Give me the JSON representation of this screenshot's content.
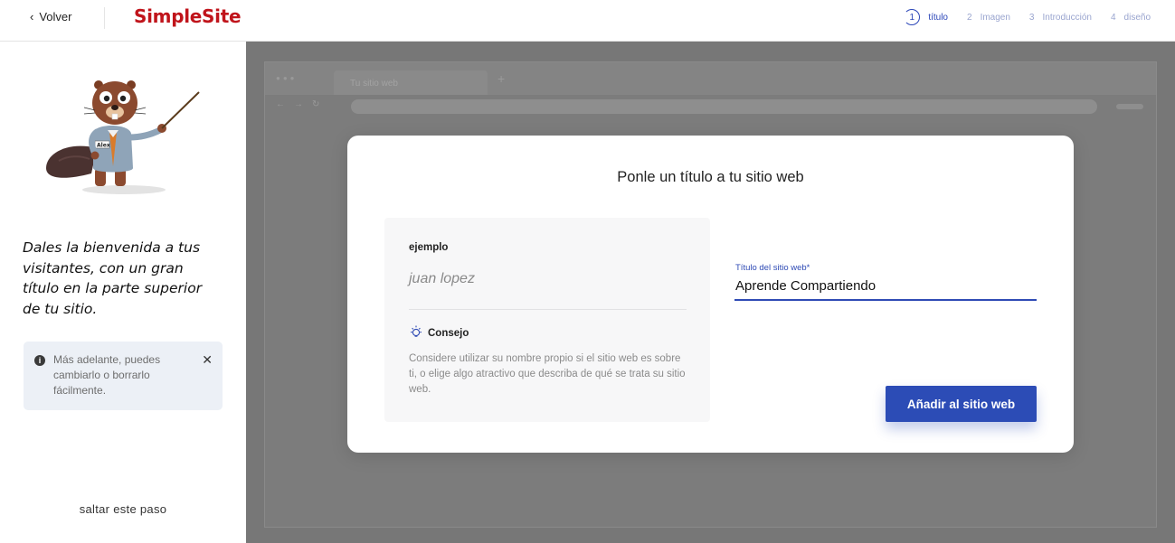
{
  "header": {
    "back_label": "Volver",
    "logo": "SimpleSite",
    "steps": [
      {
        "num": "1",
        "label": "título",
        "active": true
      },
      {
        "num": "2",
        "label": "Imagen",
        "active": false
      },
      {
        "num": "3",
        "label": "Introducción",
        "active": false
      },
      {
        "num": "4",
        "label": "diseño",
        "active": false
      }
    ]
  },
  "sidebar": {
    "mascot_badge": "Alex",
    "welcome_text": "Dales la bienvenida a tus visitantes, con un gran título en la parte superior de tu sitio.",
    "info_text": "Más adelante, puedes cambiarlo o borrarlo fácilmente.",
    "skip_label": "saltar este paso"
  },
  "preview": {
    "tab_title": "Tu sitio web"
  },
  "modal": {
    "title": "Ponle un título a tu sitio web",
    "example_label": "ejemplo",
    "example_value": "juan lopez",
    "tip_title": "Consejo",
    "tip_body": "Considere utilizar su nombre propio si el sitio web es sobre ti, o elige algo atractivo que describa de qué se trata su sitio web.",
    "field_label": "Título del sitio web*",
    "field_value": "Aprende Compartiendo",
    "submit_label": "Añadir al sitio web"
  },
  "colors": {
    "brand_red": "#c0141b",
    "primary_blue": "#2c4cb6",
    "overlay_gray": "#777777"
  }
}
